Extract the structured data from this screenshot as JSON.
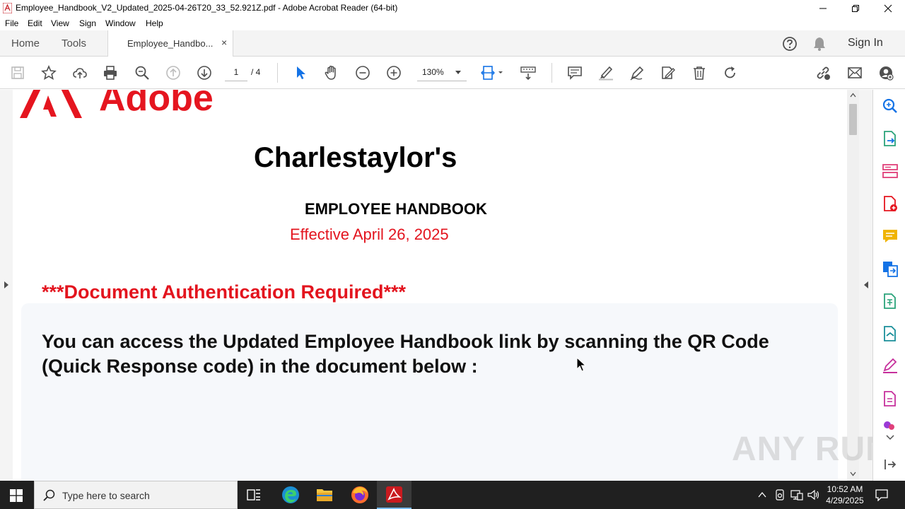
{
  "window": {
    "title": "Employee_Handbook_V2_Updated_2025-04-26T20_33_52.921Z.pdf - Adobe Acrobat Reader (64-bit)"
  },
  "menu": [
    "File",
    "Edit",
    "View",
    "Sign",
    "Window",
    "Help"
  ],
  "tabs": {
    "home": "Home",
    "tools": "Tools",
    "document": "Employee_Handbo...",
    "close": "×",
    "sign_in": "Sign In"
  },
  "toolbar": {
    "current_page": "1",
    "total_pages": "/ 4",
    "zoom": "130%"
  },
  "document": {
    "logo_text": "Adobe",
    "company": "Charlestaylor's",
    "handbook_title": "EMPLOYEE HANDBOOK",
    "effective": "Effective April 26, 2025",
    "auth_notice": "***Document Authentication Required***",
    "body": "You can access the Updated Employee Handbook link by scanning the QR Code (Quick Response code) in the document below :"
  },
  "watermark": "ANY RUN",
  "taskbar": {
    "search_placeholder": "Type here to search",
    "time": "10:52 AM",
    "date": "4/29/2025"
  },
  "colors": {
    "adobe_red": "#e5151f",
    "accent_blue": "#1473e6",
    "icon_gray": "#505050"
  }
}
